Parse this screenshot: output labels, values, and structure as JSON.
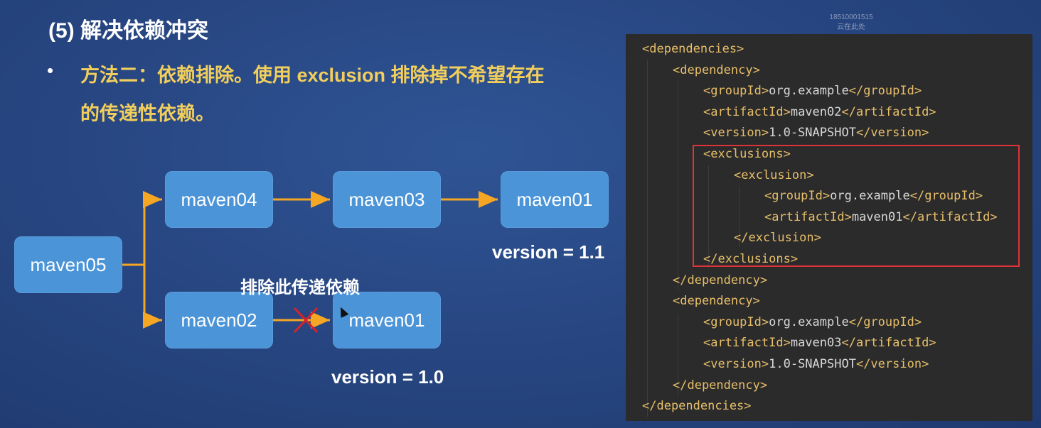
{
  "slide": {
    "title": "(5) 解决依赖冲突",
    "bullet_line1": "方法二：依赖排除。使用 exclusion 排除掉不希望存在",
    "bullet_line2": "的传递性依赖。",
    "watermark_line1": "18510001515",
    "watermark_line2": "云在此处"
  },
  "diagram": {
    "nodes": {
      "maven05": "maven05",
      "maven04": "maven04",
      "maven03": "maven03",
      "maven01_top": "maven01",
      "maven02": "maven02",
      "maven01_bottom": "maven01"
    },
    "version_top": "version = 1.1",
    "version_bottom": "version = 1.0",
    "exclude_note": "排除此传递依赖",
    "arrow_color": "#f5a623",
    "node_color": "#4b94d8",
    "cross_color": "#d8222c"
  },
  "code": {
    "lines": [
      {
        "indent": 0,
        "open": "<dependencies>",
        "text": "",
        "close": ""
      },
      {
        "indent": 1,
        "open": "<dependency>",
        "text": "",
        "close": ""
      },
      {
        "indent": 2,
        "open": "<groupId>",
        "text": "org.example",
        "close": "</groupId>"
      },
      {
        "indent": 2,
        "open": "<artifactId>",
        "text": "maven02",
        "close": "</artifactId>"
      },
      {
        "indent": 2,
        "open": "<version>",
        "text": "1.0-SNAPSHOT",
        "close": "</version>"
      },
      {
        "indent": 2,
        "open": "<exclusions>",
        "text": "",
        "close": ""
      },
      {
        "indent": 3,
        "open": "<exclusion>",
        "text": "",
        "close": ""
      },
      {
        "indent": 4,
        "open": "<groupId>",
        "text": "org.example",
        "close": "</groupId>"
      },
      {
        "indent": 4,
        "open": "<artifactId>",
        "text": "maven01",
        "close": "</artifactId>"
      },
      {
        "indent": 3,
        "open": "</exclusion>",
        "text": "",
        "close": ""
      },
      {
        "indent": 2,
        "open": "</exclusions>",
        "text": "",
        "close": ""
      },
      {
        "indent": 1,
        "open": "</dependency>",
        "text": "",
        "close": ""
      },
      {
        "indent": 1,
        "open": "<dependency>",
        "text": "",
        "close": ""
      },
      {
        "indent": 2,
        "open": "<groupId>",
        "text": "org.example",
        "close": "</groupId>"
      },
      {
        "indent": 2,
        "open": "<artifactId>",
        "text": "maven03",
        "close": "</artifactId>"
      },
      {
        "indent": 2,
        "open": "<version>",
        "text": "1.0-SNAPSHOT",
        "close": "</version>"
      },
      {
        "indent": 1,
        "open": "</dependency>",
        "text": "",
        "close": ""
      },
      {
        "indent": 0,
        "open": "</dependencies>",
        "text": "",
        "close": ""
      }
    ],
    "highlight_color": "#e0323a"
  }
}
